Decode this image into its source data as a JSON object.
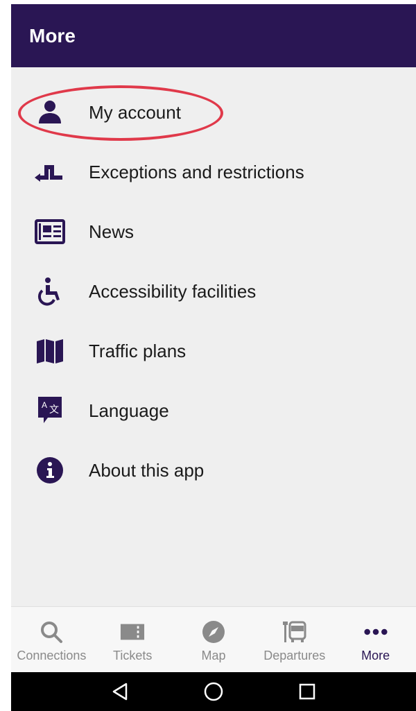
{
  "header": {
    "title": "More"
  },
  "menu": {
    "items": [
      {
        "label": "My account",
        "icon": "person-icon"
      },
      {
        "label": "Exceptions and restrictions",
        "icon": "detour-icon"
      },
      {
        "label": "News",
        "icon": "newspaper-icon"
      },
      {
        "label": "Accessibility facilities",
        "icon": "wheelchair-icon"
      },
      {
        "label": "Traffic plans",
        "icon": "map-book-icon"
      },
      {
        "label": "Language",
        "icon": "translate-icon"
      },
      {
        "label": "About this app",
        "icon": "info-icon"
      }
    ]
  },
  "tabs": {
    "items": [
      {
        "label": "Connections",
        "icon": "search-icon",
        "active": false
      },
      {
        "label": "Tickets",
        "icon": "ticket-icon",
        "active": false
      },
      {
        "label": "Map",
        "icon": "compass-icon",
        "active": false
      },
      {
        "label": "Departures",
        "icon": "bus-stop-icon",
        "active": false
      },
      {
        "label": "More",
        "icon": "more-dots-icon",
        "active": true
      }
    ]
  },
  "system_nav": {
    "buttons": [
      "back-icon",
      "home-icon",
      "recents-icon"
    ]
  },
  "colors": {
    "primary": "#2a1654",
    "background": "#efefef",
    "inactive_tab": "#8a8a8a",
    "highlight": "#e0394a"
  }
}
